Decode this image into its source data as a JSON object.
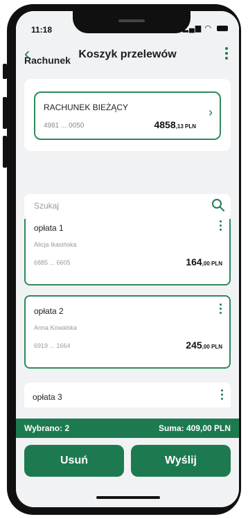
{
  "status": {
    "time": "11:18",
    "signal_icon": "signal-icon",
    "wifi_icon": "wifi-icon",
    "battery_icon": "battery-icon"
  },
  "header": {
    "title": "Koszyk przelewów",
    "back_icon": "chevron-left-icon",
    "menu_icon": "kebab-menu-icon"
  },
  "account_section": {
    "label": "Rachunek",
    "account": {
      "name": "RACHUNEK BIEŻĄCY",
      "number": "4981 ... 0050",
      "amount_main": "4858",
      "amount_dec": ",13",
      "currency": "PLN"
    }
  },
  "search": {
    "placeholder": "Szukaj"
  },
  "transfers": [
    {
      "title": "opłata 1",
      "recipient": "Alicja Ikasińska",
      "account": "6885 ... 6605",
      "amount_main": "164",
      "amount_dec": ",00",
      "currency": "PLN"
    },
    {
      "title": "opłata 2",
      "recipient": "Anna Kowalska",
      "account": "6919 ... 1664",
      "amount_main": "245",
      "amount_dec": ",00",
      "currency": "PLN"
    },
    {
      "title": "opłata 3",
      "recipient": "",
      "account": "",
      "amount_main": "",
      "amount_dec": "",
      "currency": ""
    }
  ],
  "summary": {
    "selected": "Wybrano: 2",
    "total": "Suma: 409,00 PLN"
  },
  "actions": {
    "delete_label": "Usuń",
    "send_label": "Wyślij"
  },
  "colors": {
    "accent": "#1d7a50",
    "border": "#2d8a5c",
    "background": "#f1f2f3"
  }
}
